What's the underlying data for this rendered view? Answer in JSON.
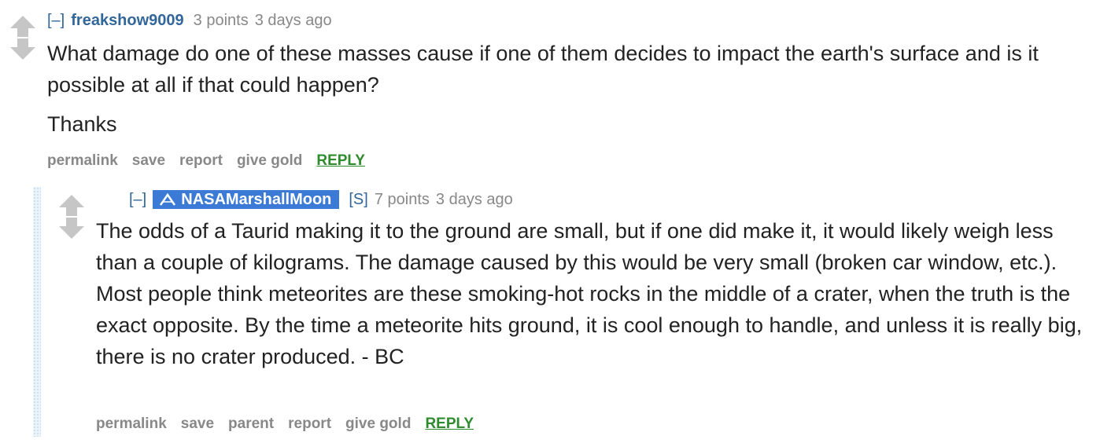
{
  "comment": {
    "expand_label": "[–]",
    "author": "freakshow9009",
    "score": "3 points",
    "time": "3 days ago",
    "body": [
      "What damage do one of these masses cause if one of them decides to impact the earth's surface and is it possible at all if that could happen?",
      "Thanks"
    ],
    "buttons": {
      "permalink": "permalink",
      "save": "save",
      "report": "report",
      "give_gold": "give gold",
      "reply": "REPLY"
    }
  },
  "reply": {
    "expand_label": "[–]",
    "author": "NASAMarshallMoon",
    "author_badge_color": "#3b7bd5",
    "author_icon": "nasa-chevron-icon",
    "submitter_tag": "[S]",
    "score": "7 points",
    "time": "3 days ago",
    "body": [
      "The odds of a Taurid making it to the ground are small, but if one did make it, it would likely weigh less than a couple of kilograms. The damage caused by this would be very small (broken car window, etc.). Most people think meteorites are these smoking-hot rocks in the middle of a crater, when the truth is the exact opposite. By the time a meteorite hits ground, it is cool enough to handle, and unless it is really big, there is no crater produced. - BC"
    ],
    "buttons": {
      "permalink": "permalink",
      "save": "save",
      "parent": "parent",
      "report": "report",
      "give_gold": "give gold",
      "reply": "REPLY"
    }
  },
  "colors": {
    "link_blue": "#336699",
    "muted_gray": "#888888",
    "reply_green": "#2e8b2e",
    "arrow_gray": "#c6c6c6"
  }
}
